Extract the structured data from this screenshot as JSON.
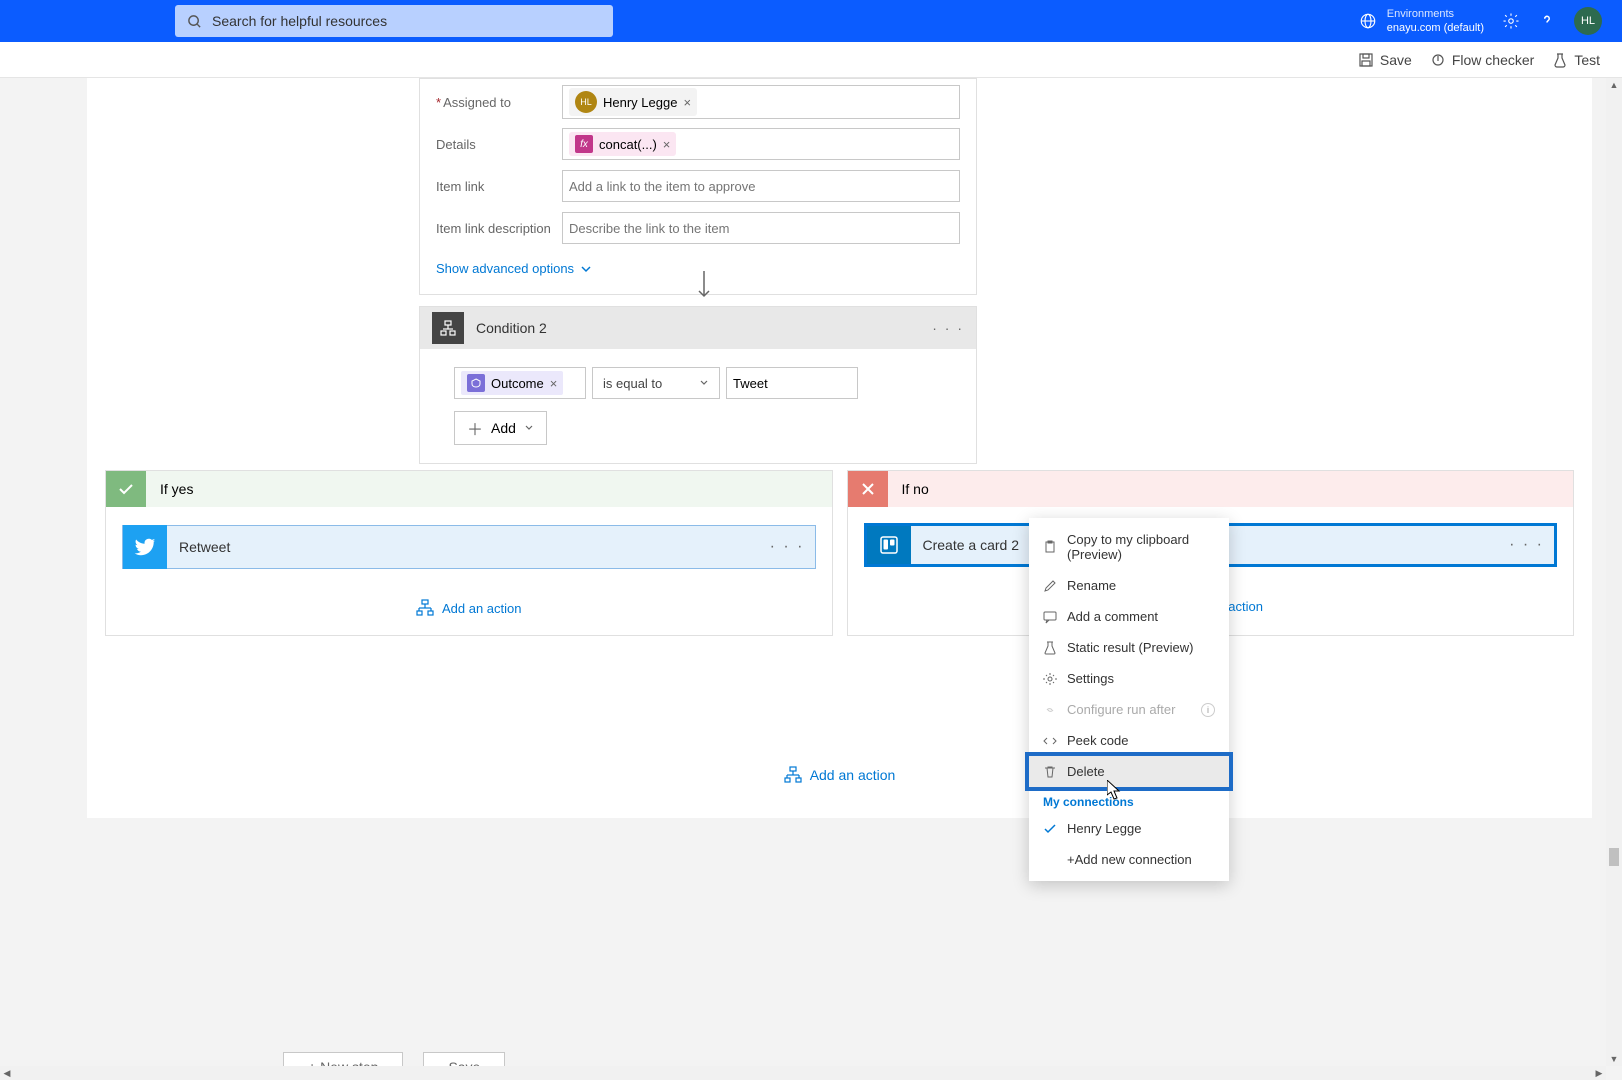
{
  "search": {
    "placeholder": "Search for helpful resources"
  },
  "env": {
    "label": "Environments",
    "name": "enayu.com (default)"
  },
  "user": {
    "initials": "HL"
  },
  "cmdbar": {
    "save": "Save",
    "checker": "Flow checker",
    "test": "Test"
  },
  "form": {
    "assigned_label": "Assigned to",
    "assigned_person": "Henry Legge",
    "assigned_initials": "HL",
    "details_label": "Details",
    "details_token": "concat(...)",
    "link_label": "Item link",
    "link_placeholder": "Add a link to the item to approve",
    "linkdesc_label": "Item link description",
    "linkdesc_placeholder": "Describe the link to the item",
    "advanced": "Show advanced options"
  },
  "condition": {
    "title": "Condition 2",
    "outcome": "Outcome",
    "operator": "is equal to",
    "value": "Tweet",
    "add": "Add"
  },
  "branches": {
    "yes": {
      "title": "If yes",
      "action": "Retweet",
      "add": "Add an action"
    },
    "no": {
      "title": "If no",
      "action": "Create a card 2",
      "add": "Add an action"
    }
  },
  "bottom_add": "Add an action",
  "menu": {
    "copy": "Copy to my clipboard (Preview)",
    "rename": "Rename",
    "comment": "Add a comment",
    "static": "Static result (Preview)",
    "settings": "Settings",
    "runafter": "Configure run after",
    "peek": "Peek code",
    "delete": "Delete",
    "myconn": "My connections",
    "conn_user": "Henry Legge",
    "addconn": "+Add new connection"
  },
  "footer": {
    "newstep": "+ New step",
    "save": "Save"
  }
}
